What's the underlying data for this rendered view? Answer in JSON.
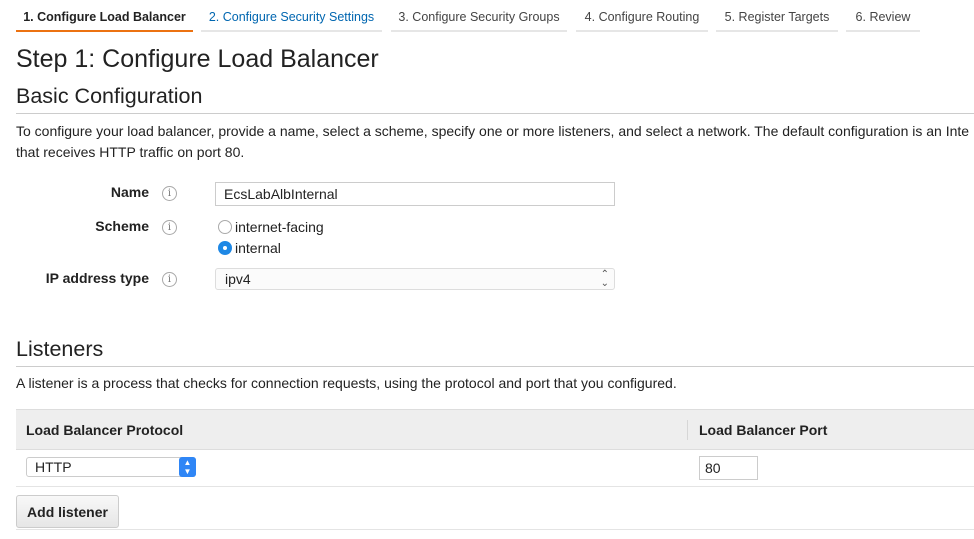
{
  "wizard": {
    "tabs": [
      "1. Configure Load Balancer",
      "2. Configure Security Settings",
      "3. Configure Security Groups",
      "4. Configure Routing",
      "5. Register Targets",
      "6. Review"
    ],
    "active_tab": 0,
    "accent_color": "#ec7211",
    "link_color": "#0066b0"
  },
  "page": {
    "title": "Step 1: Configure Load Balancer"
  },
  "basic": {
    "heading": "Basic Configuration",
    "description_line1": "To configure your load balancer, provide a name, select a scheme, specify one or more listeners, and select a network. The default configuration is an Inte",
    "description_line2": "that receives HTTP traffic on port 80.",
    "name_label": "Name",
    "name_value": "EcsLabAlbInternal",
    "scheme_label": "Scheme",
    "scheme_options": [
      "internet-facing",
      "internal"
    ],
    "scheme_selected": "internal",
    "ip_label": "IP address type",
    "ip_value": "ipv4",
    "info_glyph": "i"
  },
  "listeners": {
    "heading": "Listeners",
    "description": "A listener is a process that checks for connection requests, using the protocol and port that you configured.",
    "col_protocol": "Load Balancer Protocol",
    "col_port": "Load Balancer Port",
    "rows": [
      {
        "protocol": "HTTP",
        "port": "80"
      }
    ],
    "add_button": "Add listener",
    "stepper_color": "#2f86f6"
  }
}
